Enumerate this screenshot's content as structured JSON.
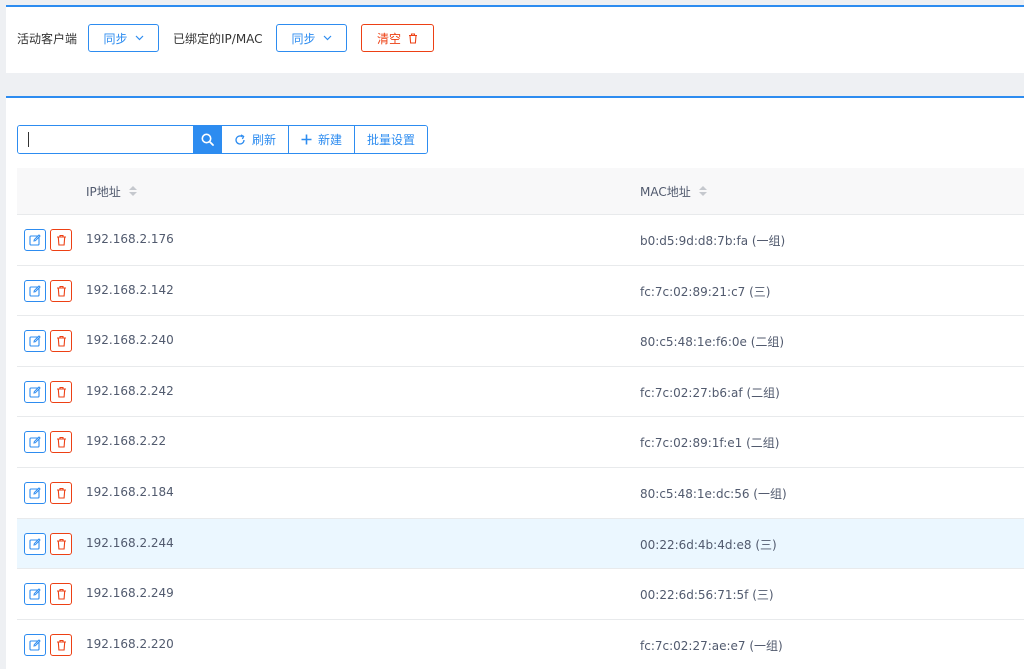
{
  "top_bar": {
    "active_clients_label": "活动客户端",
    "active_sync_label": "同步",
    "bound_label": "已绑定的IP/MAC",
    "bound_sync_label": "同步",
    "clear_label": "清空"
  },
  "toolbar": {
    "search_value": "",
    "refresh_label": "刷新",
    "new_label": "新建",
    "batch_label": "批量设置"
  },
  "table": {
    "columns": [
      "IP地址",
      "MAC地址"
    ],
    "rows": [
      {
        "ip": "192.168.2.176",
        "mac": "b0:d5:9d:d8:7b:fa (一组)"
      },
      {
        "ip": "192.168.2.142",
        "mac": "fc:7c:02:89:21:c7 (三)"
      },
      {
        "ip": "192.168.2.240",
        "mac": "80:c5:48:1e:f6:0e (二组)"
      },
      {
        "ip": "192.168.2.242",
        "mac": "fc:7c:02:27:b6:af (二组)"
      },
      {
        "ip": "192.168.2.22",
        "mac": "fc:7c:02:89:1f:e1 (二组)"
      },
      {
        "ip": "192.168.2.184",
        "mac": "80:c5:48:1e:dc:56 (一组)"
      },
      {
        "ip": "192.168.2.244",
        "mac": "00:22:6d:4b:4d:e8 (三)"
      },
      {
        "ip": "192.168.2.249",
        "mac": "00:22:6d:56:71:5f (三)"
      },
      {
        "ip": "192.168.2.220",
        "mac": "fc:7c:02:27:ae:e7 (一组)"
      }
    ],
    "highlighted_row_index": 6
  },
  "colors": {
    "primary": "#2d8cf0",
    "danger": "#ed4014",
    "highlight_row": "#ebf7ff"
  },
  "icons": {
    "chevron": "chevron-down-icon",
    "trash": "trash-icon",
    "search": "search-icon",
    "refresh": "refresh-icon",
    "add": "plus-icon",
    "edit": "edit-icon"
  }
}
